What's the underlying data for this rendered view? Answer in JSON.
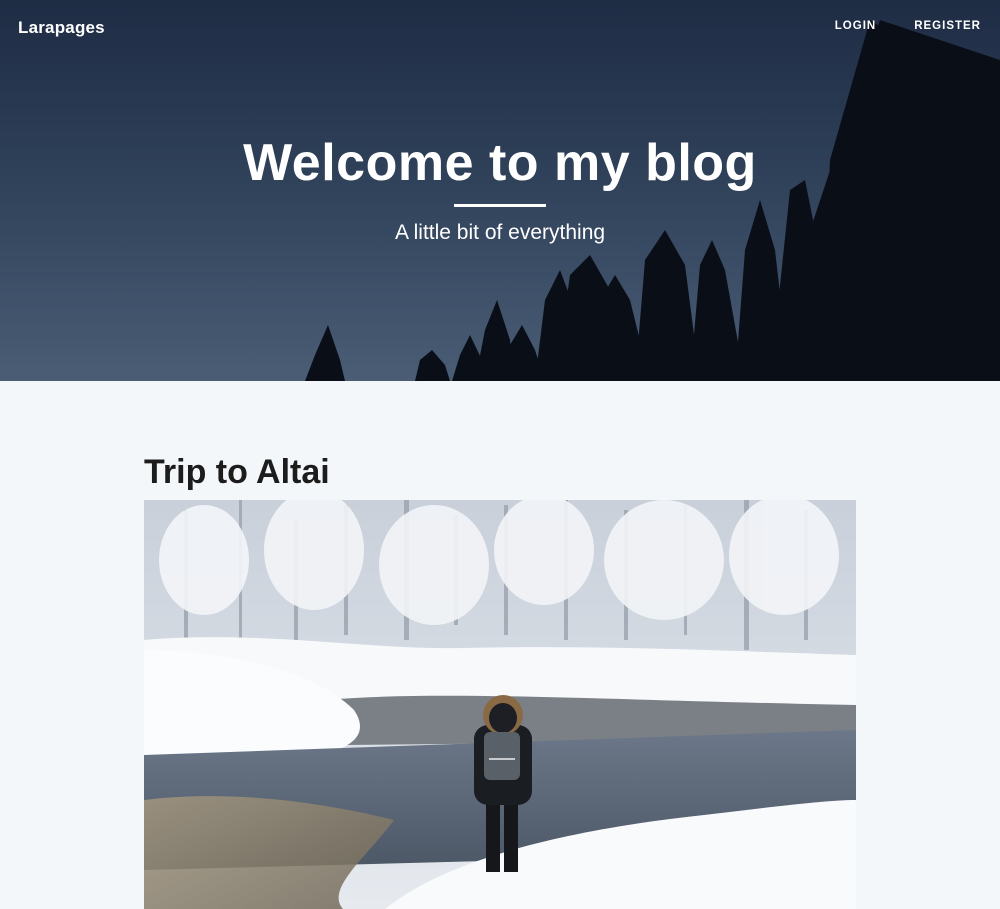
{
  "header": {
    "brand": "Larapages",
    "nav": [
      {
        "label": "LOGIN"
      },
      {
        "label": "REGISTER"
      }
    ]
  },
  "hero": {
    "title": "Welcome to my blog",
    "subtitle": "A little bit of everything"
  },
  "posts": [
    {
      "title": "Trip to Altai",
      "image_icon": "snowy-forest-river-photo"
    }
  ],
  "colors": {
    "hero_top": "#1e2c44",
    "hero_bottom": "#4a5d75",
    "page_bg": "#f4f7fa",
    "text_dark": "#1c1c1c"
  }
}
